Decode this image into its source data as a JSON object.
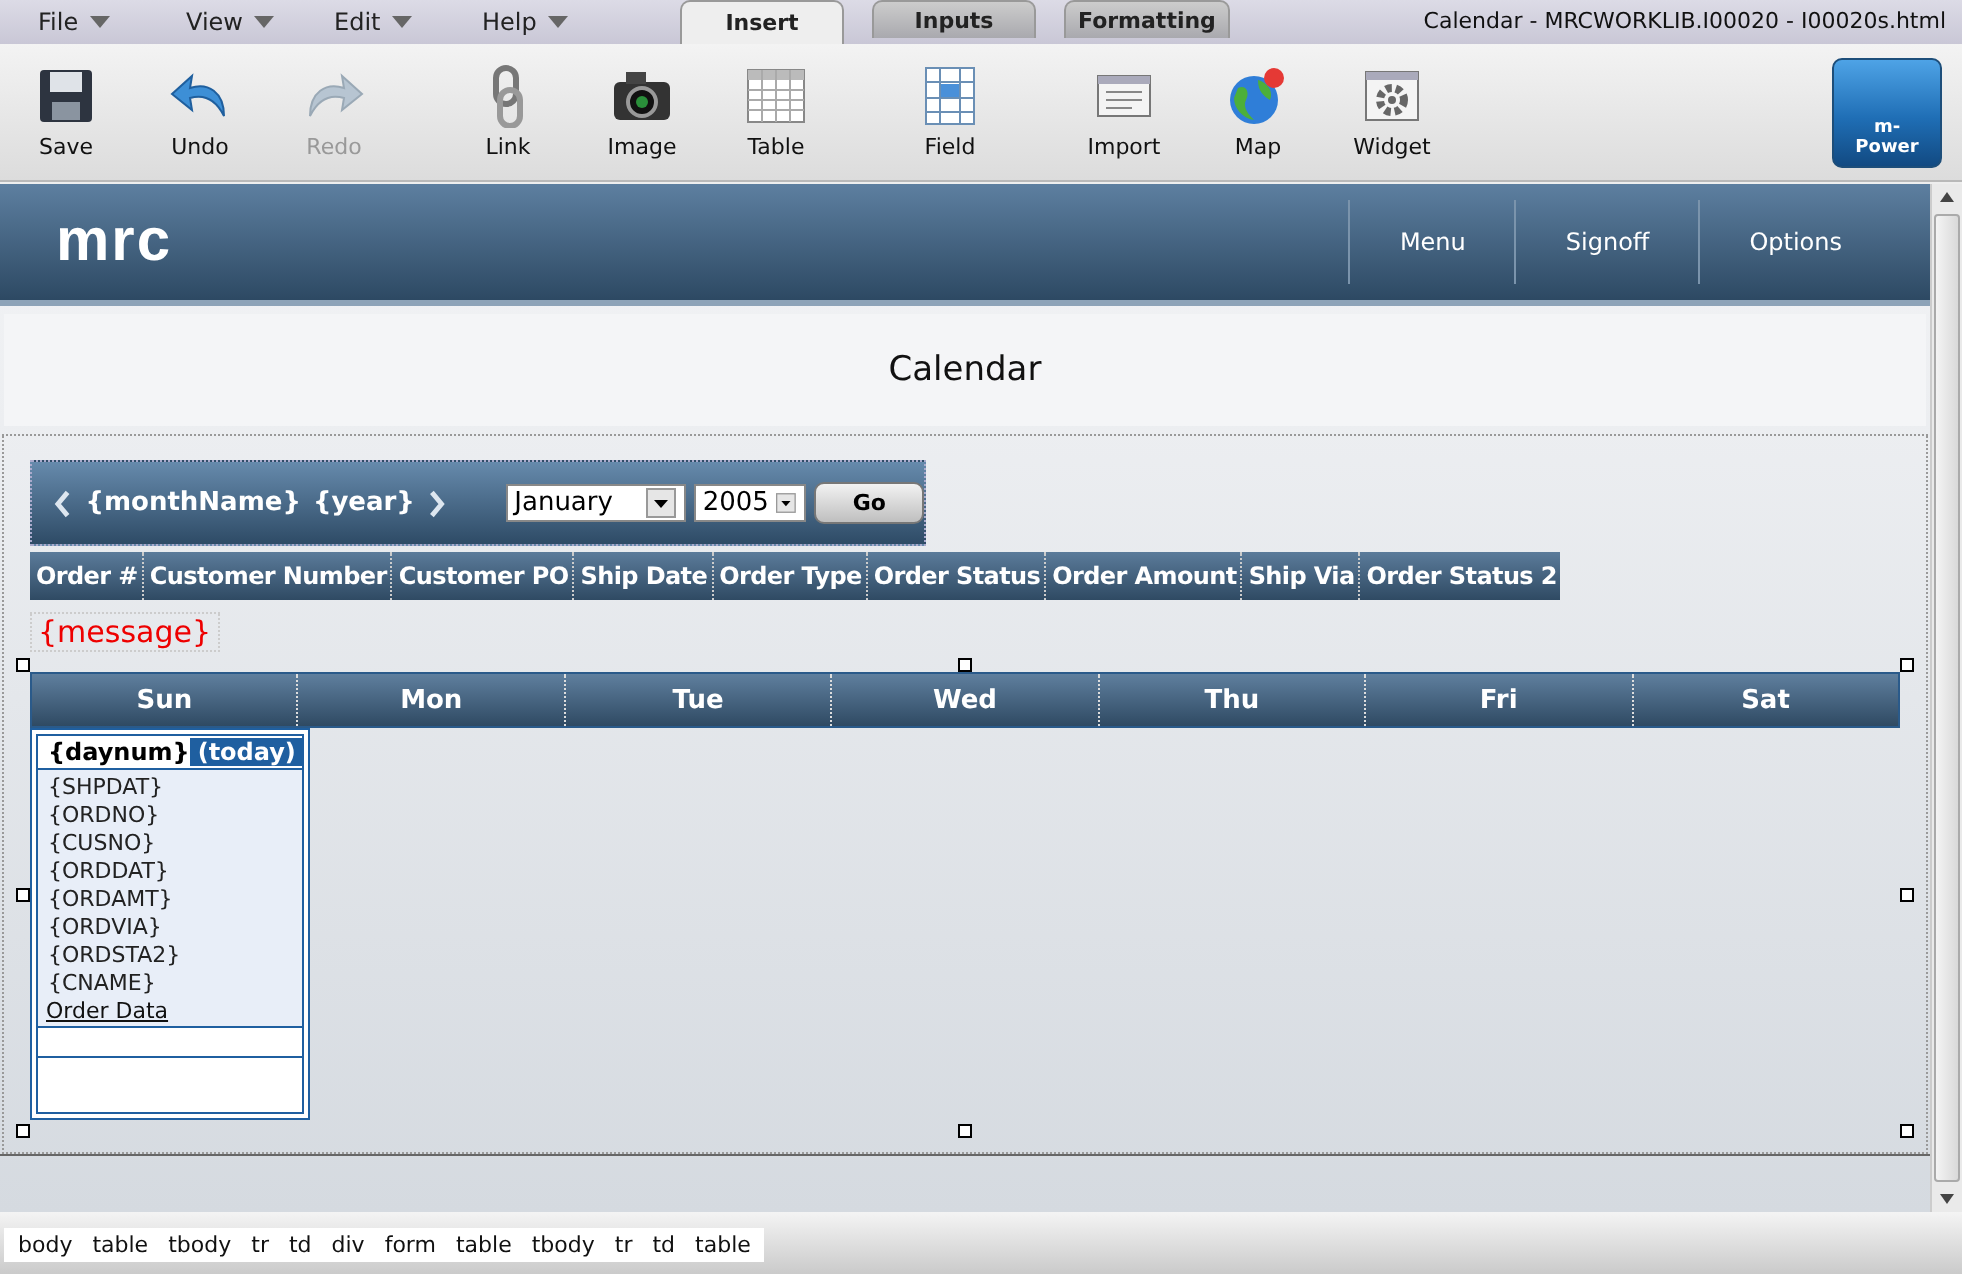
{
  "menus": [
    {
      "label": "File"
    },
    {
      "label": "View"
    },
    {
      "label": "Edit"
    },
    {
      "label": "Help"
    }
  ],
  "tabs": [
    {
      "label": "Insert",
      "selected": true
    },
    {
      "label": "Inputs",
      "selected": false
    },
    {
      "label": "Formatting",
      "selected": false
    }
  ],
  "window_title": "Calendar - MRCWORKLIB.I00020 - I00020s.html",
  "toolbar": [
    {
      "label": "Save",
      "kind": "save",
      "disabled": false
    },
    {
      "label": "Undo",
      "kind": "undo",
      "disabled": false
    },
    {
      "label": "Redo",
      "kind": "redo",
      "disabled": true
    },
    {
      "label": "Link",
      "kind": "link",
      "disabled": false
    },
    {
      "label": "Image",
      "kind": "camera",
      "disabled": false
    },
    {
      "label": "Table",
      "kind": "table",
      "disabled": false
    },
    {
      "label": "Field",
      "kind": "field",
      "disabled": false
    },
    {
      "label": "Import",
      "kind": "import",
      "disabled": false
    },
    {
      "label": "Map",
      "kind": "globe",
      "disabled": false
    },
    {
      "label": "Widget",
      "kind": "widget",
      "disabled": false
    }
  ],
  "logo_button": {
    "label": "m-Power"
  },
  "page": {
    "logo": "mrc",
    "nav": [
      "Menu",
      "Signoff",
      "Options"
    ],
    "title": "Calendar",
    "month_nav": {
      "month": "{monthName}",
      "year": "{year}",
      "month_select": "January",
      "year_select": "2005",
      "go": "Go"
    },
    "columns": [
      "Order #",
      "Customer Number",
      "Customer PO",
      "Ship Date",
      "Order Type",
      "Order Status",
      "Order Amount",
      "Ship Via",
      "Order Status 2"
    ],
    "message": "{message}",
    "weekdays": [
      "Sun",
      "Mon",
      "Tue",
      "Wed",
      "Thu",
      "Fri",
      "Sat"
    ],
    "day_cell": {
      "daynum": "{daynum}",
      "today": "(today)",
      "fields": [
        "{SHPDAT}",
        "{ORDNO}",
        "{CUSNO}",
        "{ORDDAT}",
        "{ORDAMT}",
        "{ORDVIA}",
        "{ORDSTA2}",
        "{CNAME}"
      ],
      "link": "Order Data"
    }
  },
  "path": [
    "body",
    "table",
    "tbody",
    "tr",
    "td",
    "div",
    "form",
    "table",
    "tbody",
    "tr",
    "td",
    "table"
  ]
}
